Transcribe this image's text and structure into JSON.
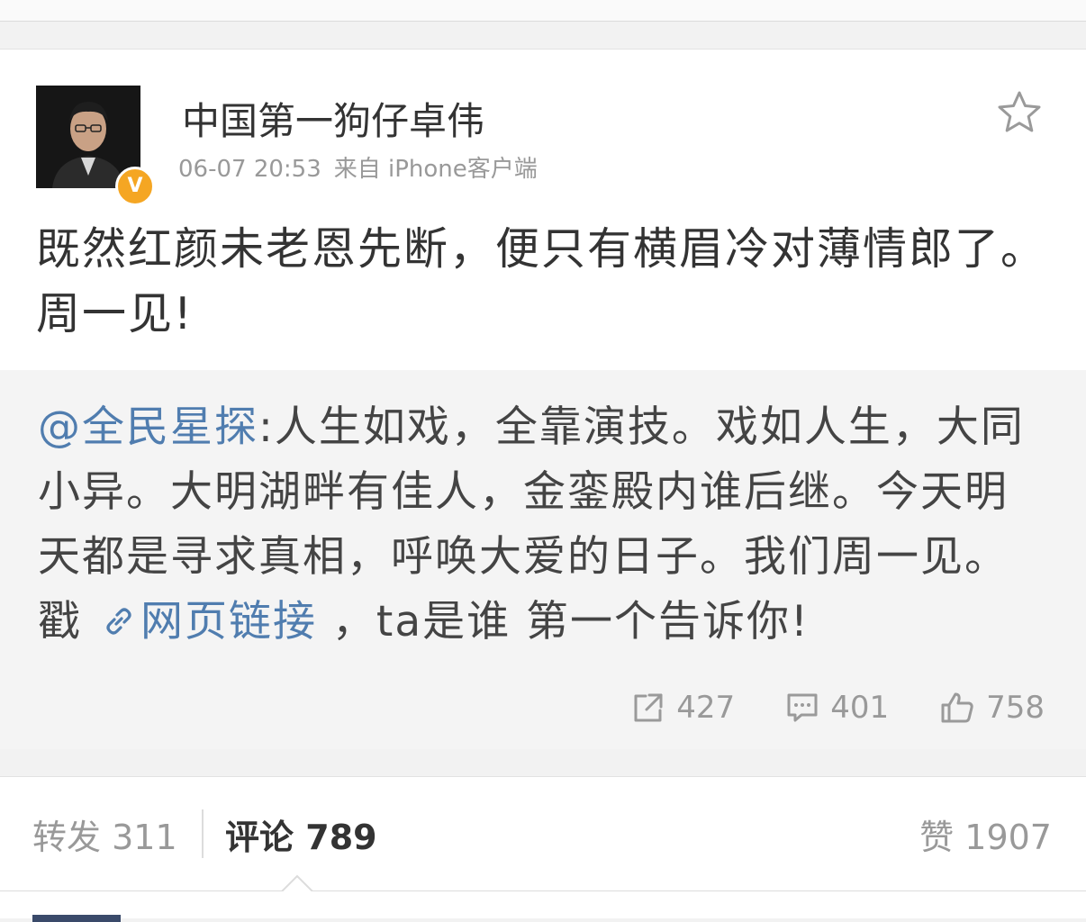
{
  "post": {
    "username": "中国第一狗仔卓伟",
    "time": "06-07 20:53",
    "source": "来自 iPhone客户端",
    "verified_badge": "V",
    "text": "既然红颜未老恩先断，便只有横眉冷对薄情郎了。周一见!",
    "icons": {
      "favorite": "star-icon",
      "verified": "verified-badge-icon"
    }
  },
  "repost": {
    "mention": "@全民星探",
    "text_before_link": ":人生如戏，全靠演技。戏如人生，大同小异。大明湖畔有佳人，金銮殿内谁后继。今天明天都是寻求真相，呼唤大爱的日子。我们周一见。戳 ",
    "link_label": "网页链接",
    "text_after_link": " ，ta是谁 第一个告诉你!",
    "actions": {
      "repost_count": "427",
      "comment_count": "401",
      "like_count": "758"
    }
  },
  "tabs": {
    "repost_label": "转发",
    "repost_count": "311",
    "comment_label": "评论",
    "comment_count": "789",
    "like_label": "赞",
    "like_count": "1907"
  },
  "colors": {
    "link": "#507daf",
    "badge": "#f5a623",
    "muted": "#999999"
  }
}
